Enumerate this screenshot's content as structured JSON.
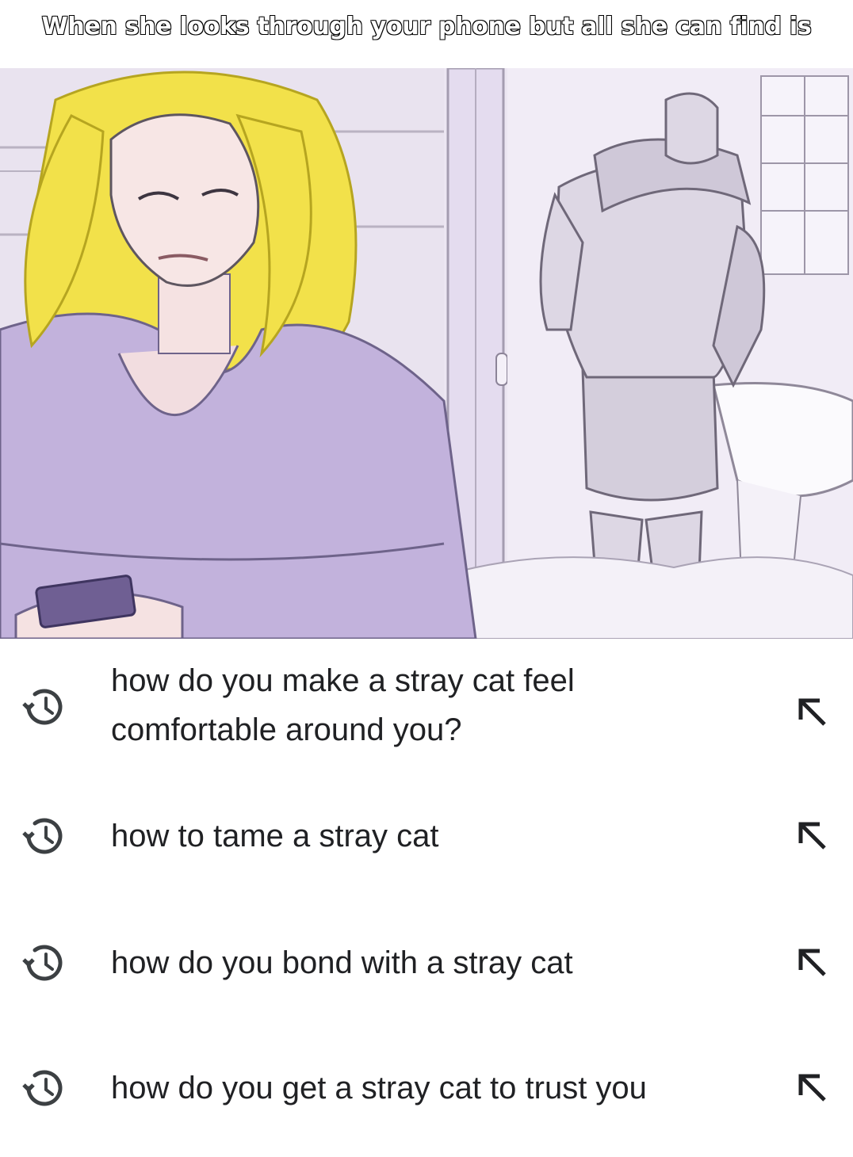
{
  "caption": "When she looks through your phone but all she can find is",
  "history": {
    "items": [
      {
        "query": "how do you make a stray cat feel comfortable around you?",
        "icon": "history-icon",
        "action_icon": "arrow-up-left-icon"
      },
      {
        "query": "how to tame a stray cat",
        "icon": "history-icon",
        "action_icon": "arrow-up-left-icon"
      },
      {
        "query": "how do you bond with a stray cat",
        "icon": "history-icon",
        "action_icon": "arrow-up-left-icon"
      },
      {
        "query": "how do you get a stray cat to trust you",
        "icon": "history-icon",
        "action_icon": "arrow-up-left-icon"
      }
    ]
  },
  "colors": {
    "text": "#202124",
    "icon": "#3c4043",
    "illustration_background": "#ece6f2",
    "hair": "#f2e14a",
    "shirt": "#c2b2dc"
  }
}
